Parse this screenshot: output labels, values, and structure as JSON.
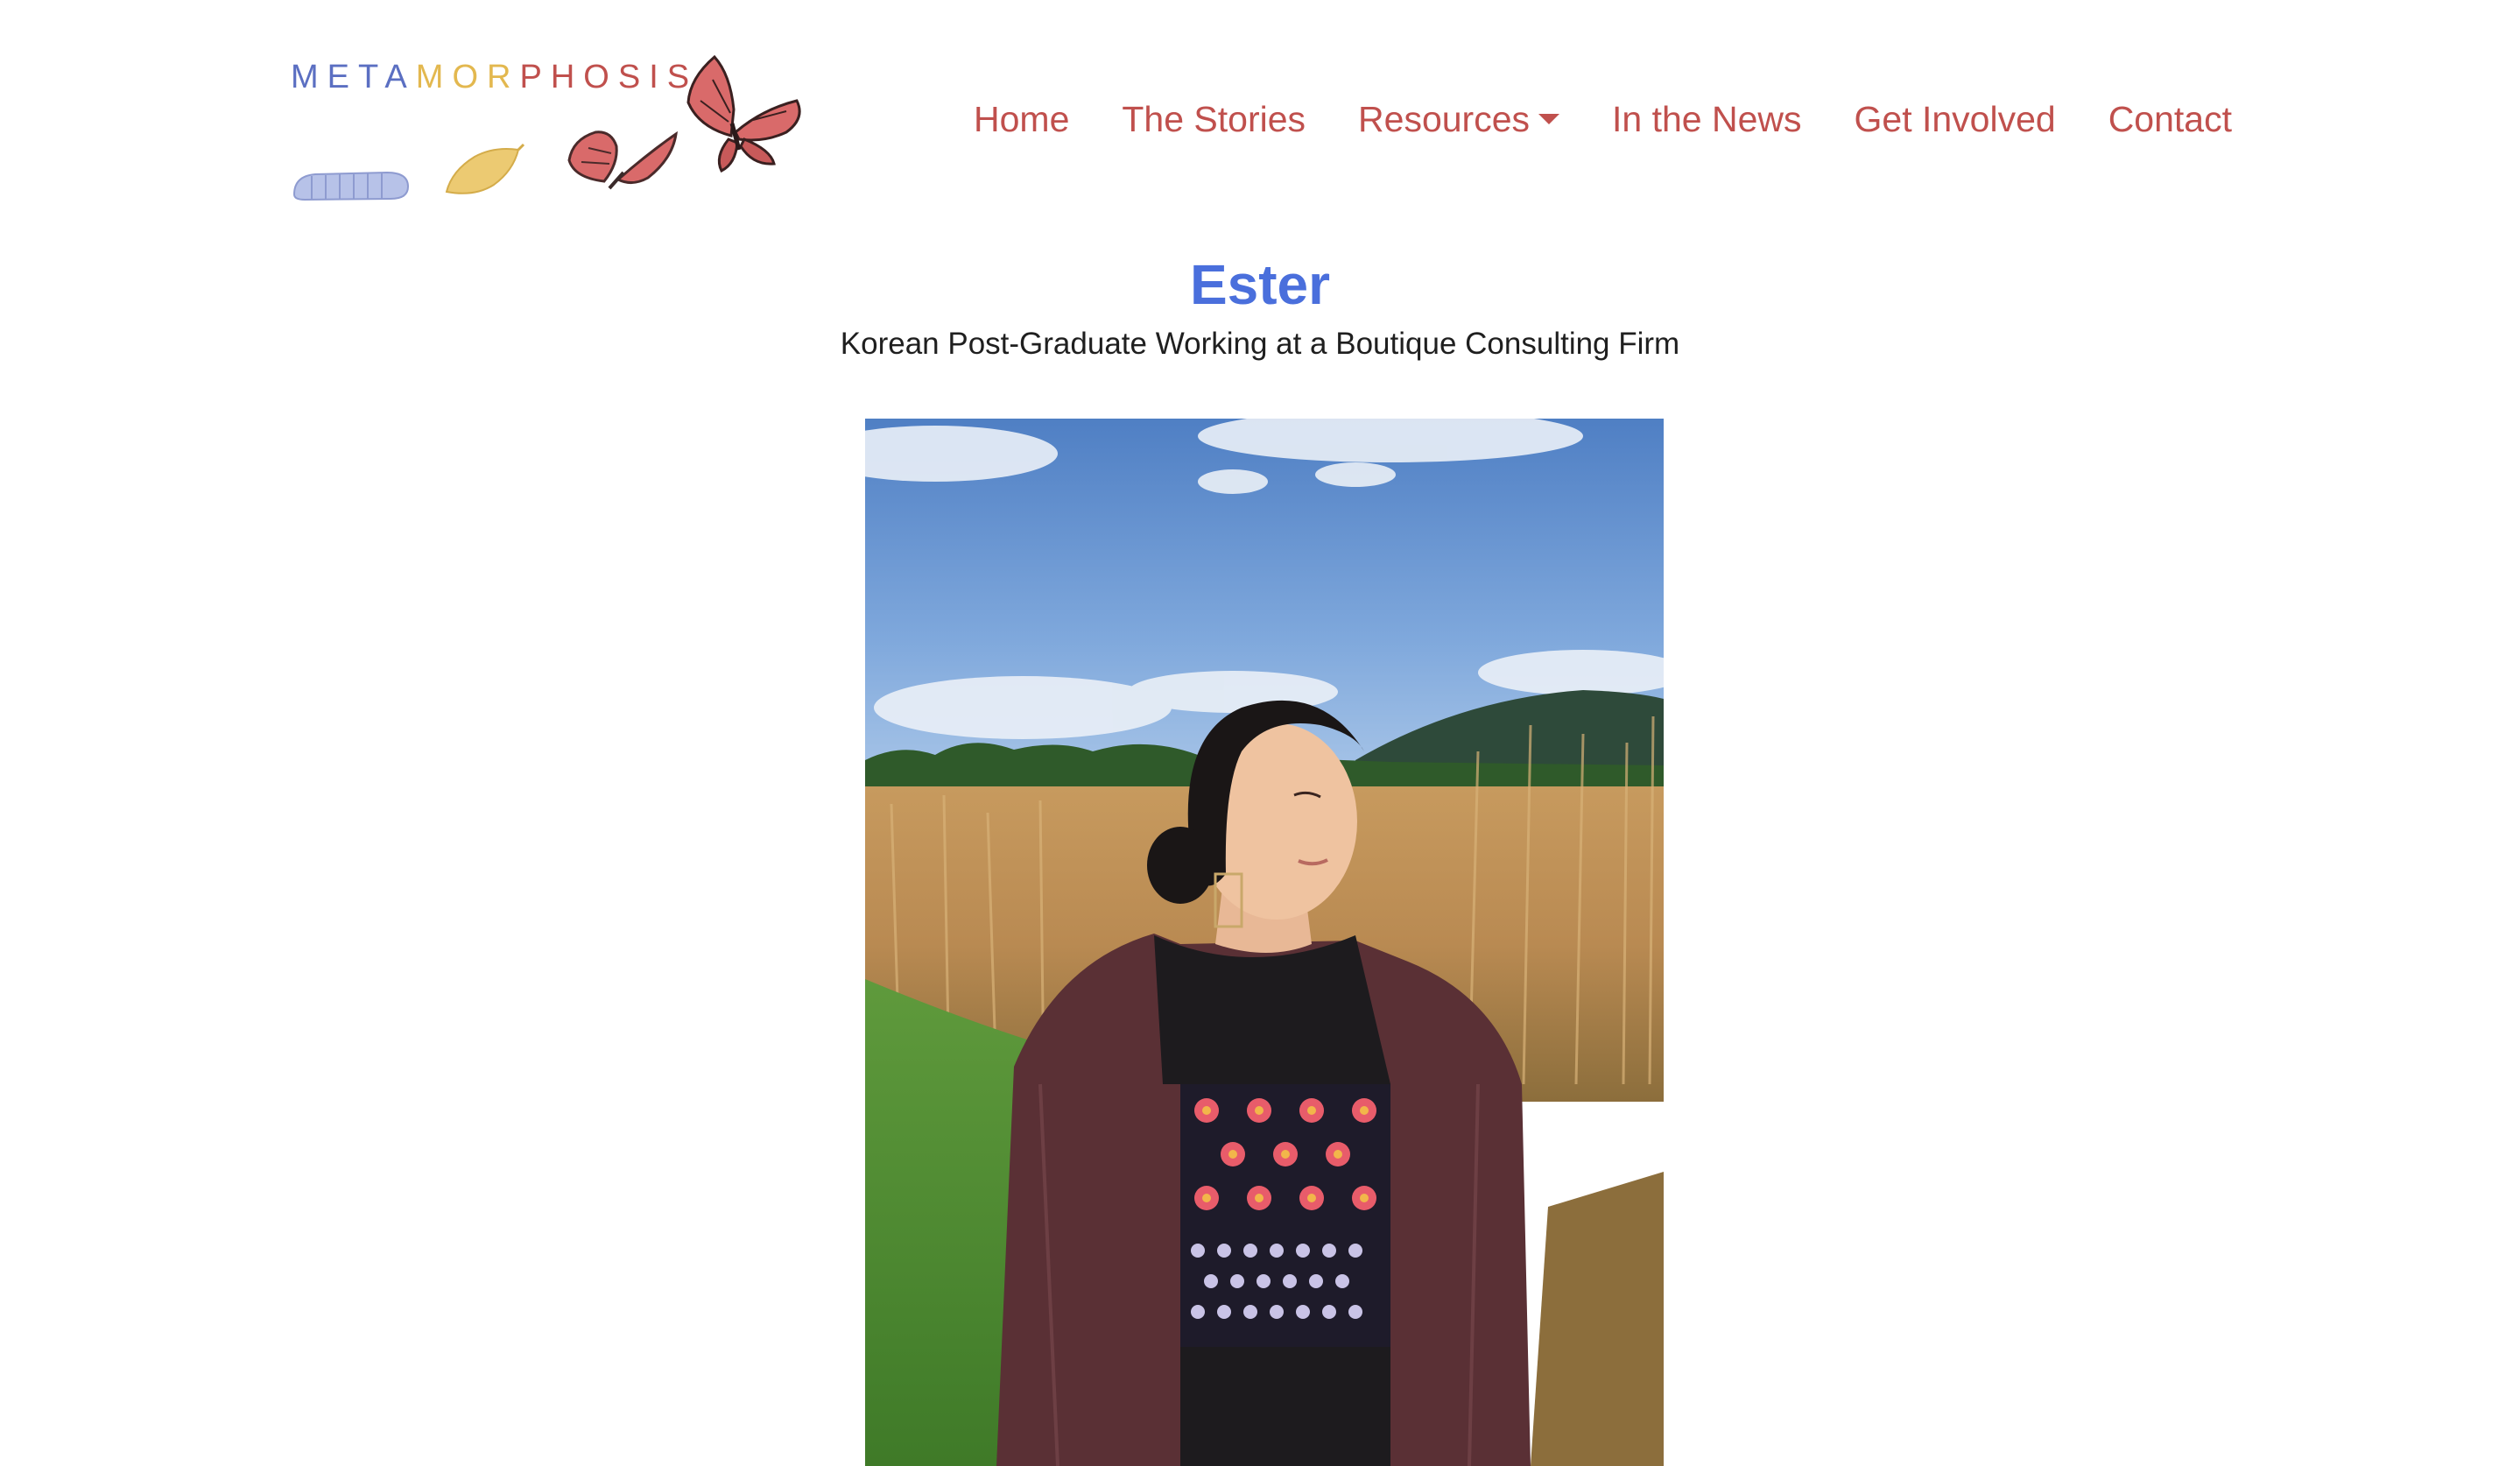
{
  "site": {
    "logo_letters": [
      {
        "ch": "M",
        "color": "#5b6fc2"
      },
      {
        "ch": "E",
        "color": "#5b6fc2"
      },
      {
        "ch": "T",
        "color": "#5b6fc2"
      },
      {
        "ch": "A",
        "color": "#5b6fc2"
      },
      {
        "ch": "M",
        "color": "#e3b84f"
      },
      {
        "ch": "O",
        "color": "#e3b84f"
      },
      {
        "ch": "R",
        "color": "#e3b84f"
      },
      {
        "ch": "P",
        "color": "#c0504d"
      },
      {
        "ch": "H",
        "color": "#c0504d"
      },
      {
        "ch": "O",
        "color": "#c0504d"
      },
      {
        "ch": "S",
        "color": "#c0504d"
      },
      {
        "ch": "I",
        "color": "#c0504d"
      },
      {
        "ch": "S",
        "color": "#c0504d"
      }
    ],
    "logo_icons": [
      "caterpillar-icon",
      "chrysalis-icon",
      "butterfly-icon",
      "butterfly-icon"
    ]
  },
  "nav": {
    "items": [
      {
        "label": "Home"
      },
      {
        "label": "The Stories"
      },
      {
        "label": "Resources",
        "has_dropdown": true
      },
      {
        "label": "In the News"
      },
      {
        "label": "Get Involved"
      },
      {
        "label": "Contact"
      }
    ],
    "color": "#c0504d"
  },
  "story": {
    "name": "Ester",
    "subtitle": "Korean Post-Graduate Working at a Boutique Consulting Firm",
    "title_color": "#4a6fdc"
  }
}
